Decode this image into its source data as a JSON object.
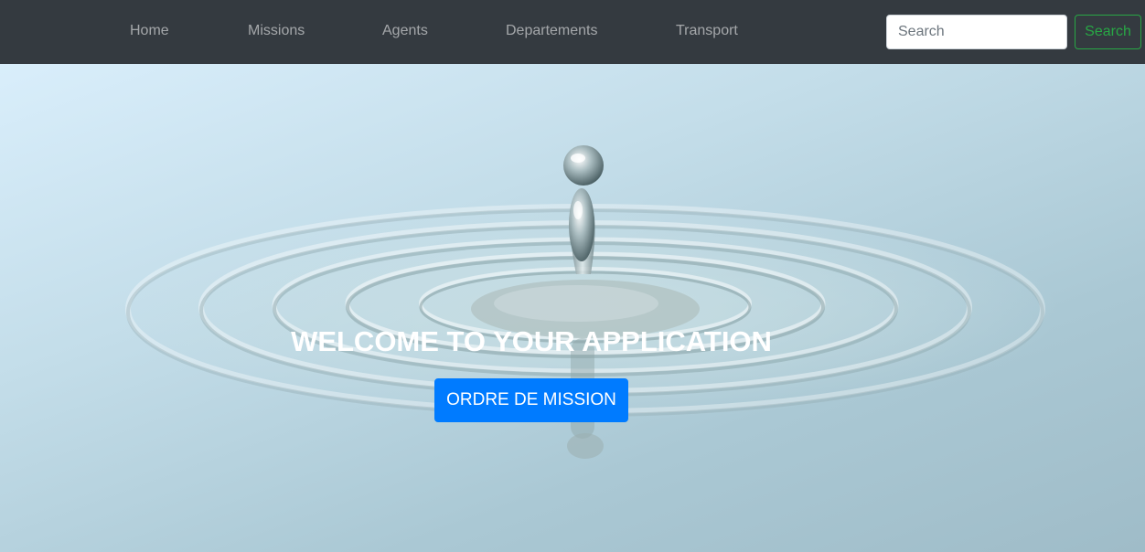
{
  "navbar": {
    "links": [
      {
        "label": "Home"
      },
      {
        "label": "Missions"
      },
      {
        "label": "Agents"
      },
      {
        "label": "Departements"
      },
      {
        "label": "Transport"
      }
    ],
    "search": {
      "placeholder": "Search",
      "button_label": "Search"
    }
  },
  "hero": {
    "title": "WELCOME TO YOUR APPLICATION",
    "button_label": "ORDRE DE MISSION"
  },
  "colors": {
    "navbar_bg": "#343a40",
    "search_button": "#28a745",
    "primary_button": "#007bff"
  }
}
